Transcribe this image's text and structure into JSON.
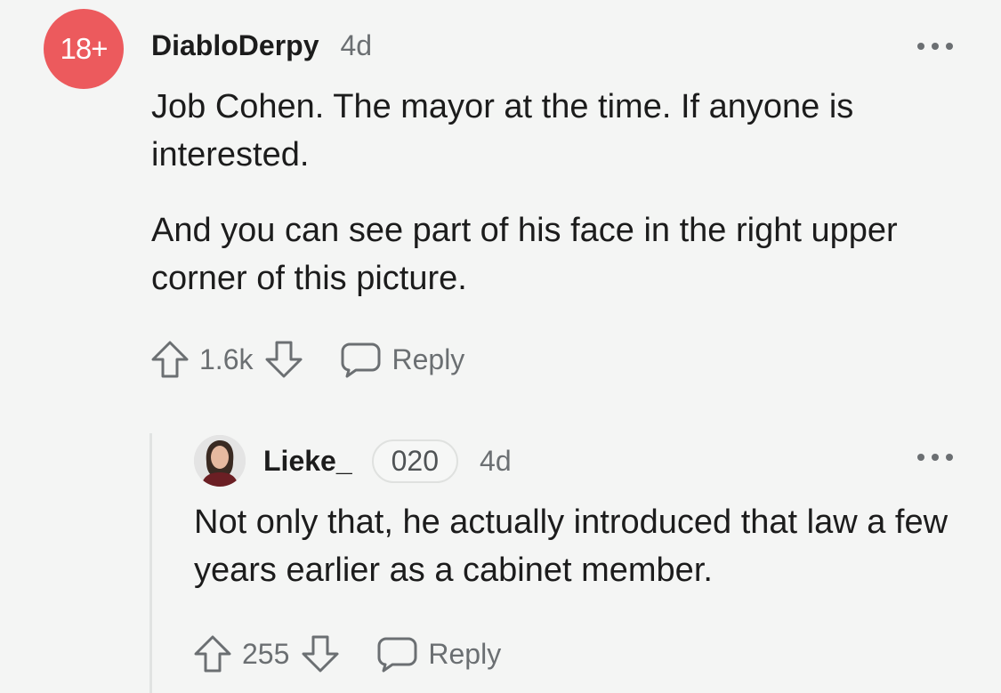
{
  "comment": {
    "avatar_badge": "18+",
    "author": "DiabloDerpy",
    "time": "4d",
    "paragraphs": [
      "Job Cohen. The mayor at the time. If anyone is interested.",
      "And you can see part of his face in the right upper corner of this picture."
    ],
    "score": "1.6k",
    "reply_label": "Reply"
  },
  "reply": {
    "author": "Lieke_",
    "flair": "020",
    "time": "4d",
    "text": "Not only that, he actually introduced that law a few years earlier as a cabinet member.",
    "score": "255",
    "reply_label": "Reply"
  },
  "colors": {
    "background": "#f4f5f4",
    "badge": "#ec5a5d",
    "muted": "#6b6f72",
    "text": "#1c1c1c"
  }
}
